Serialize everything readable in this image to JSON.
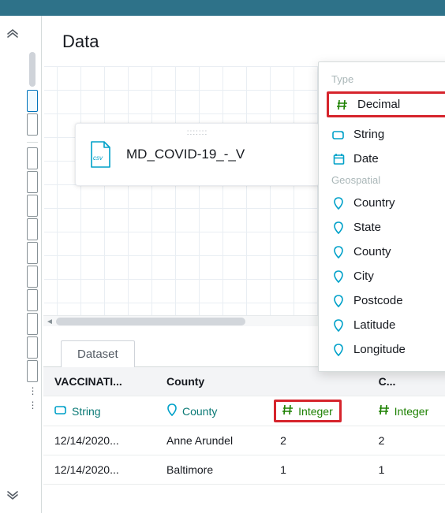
{
  "header": {
    "title": "Data"
  },
  "csv_card": {
    "filename": "MD_COVID-19_-_V"
  },
  "tabs": {
    "dataset": "Dataset"
  },
  "type_menu": {
    "group_type": "Type",
    "group_geo": "Geospatial",
    "decimal": "Decimal",
    "string": "String",
    "date": "Date",
    "country": "Country",
    "state": "State",
    "county": "County",
    "city": "City",
    "postcode": "Postcode",
    "latitude": "Latitude",
    "longitude": "Longitude"
  },
  "table": {
    "headers": {
      "col1": "VACCINATI...",
      "col2": "County",
      "col3": "",
      "col4": "C..."
    },
    "types": {
      "col1": "String",
      "col2": "County",
      "col3": "Integer",
      "col4": "Integer"
    },
    "rows": [
      {
        "c1": "12/14/2020...",
        "c2": "Anne Arundel",
        "c3": "2",
        "c4": "2"
      },
      {
        "c1": "12/14/2020...",
        "c2": "Baltimore",
        "c3": "1",
        "c4": "1"
      }
    ]
  }
}
